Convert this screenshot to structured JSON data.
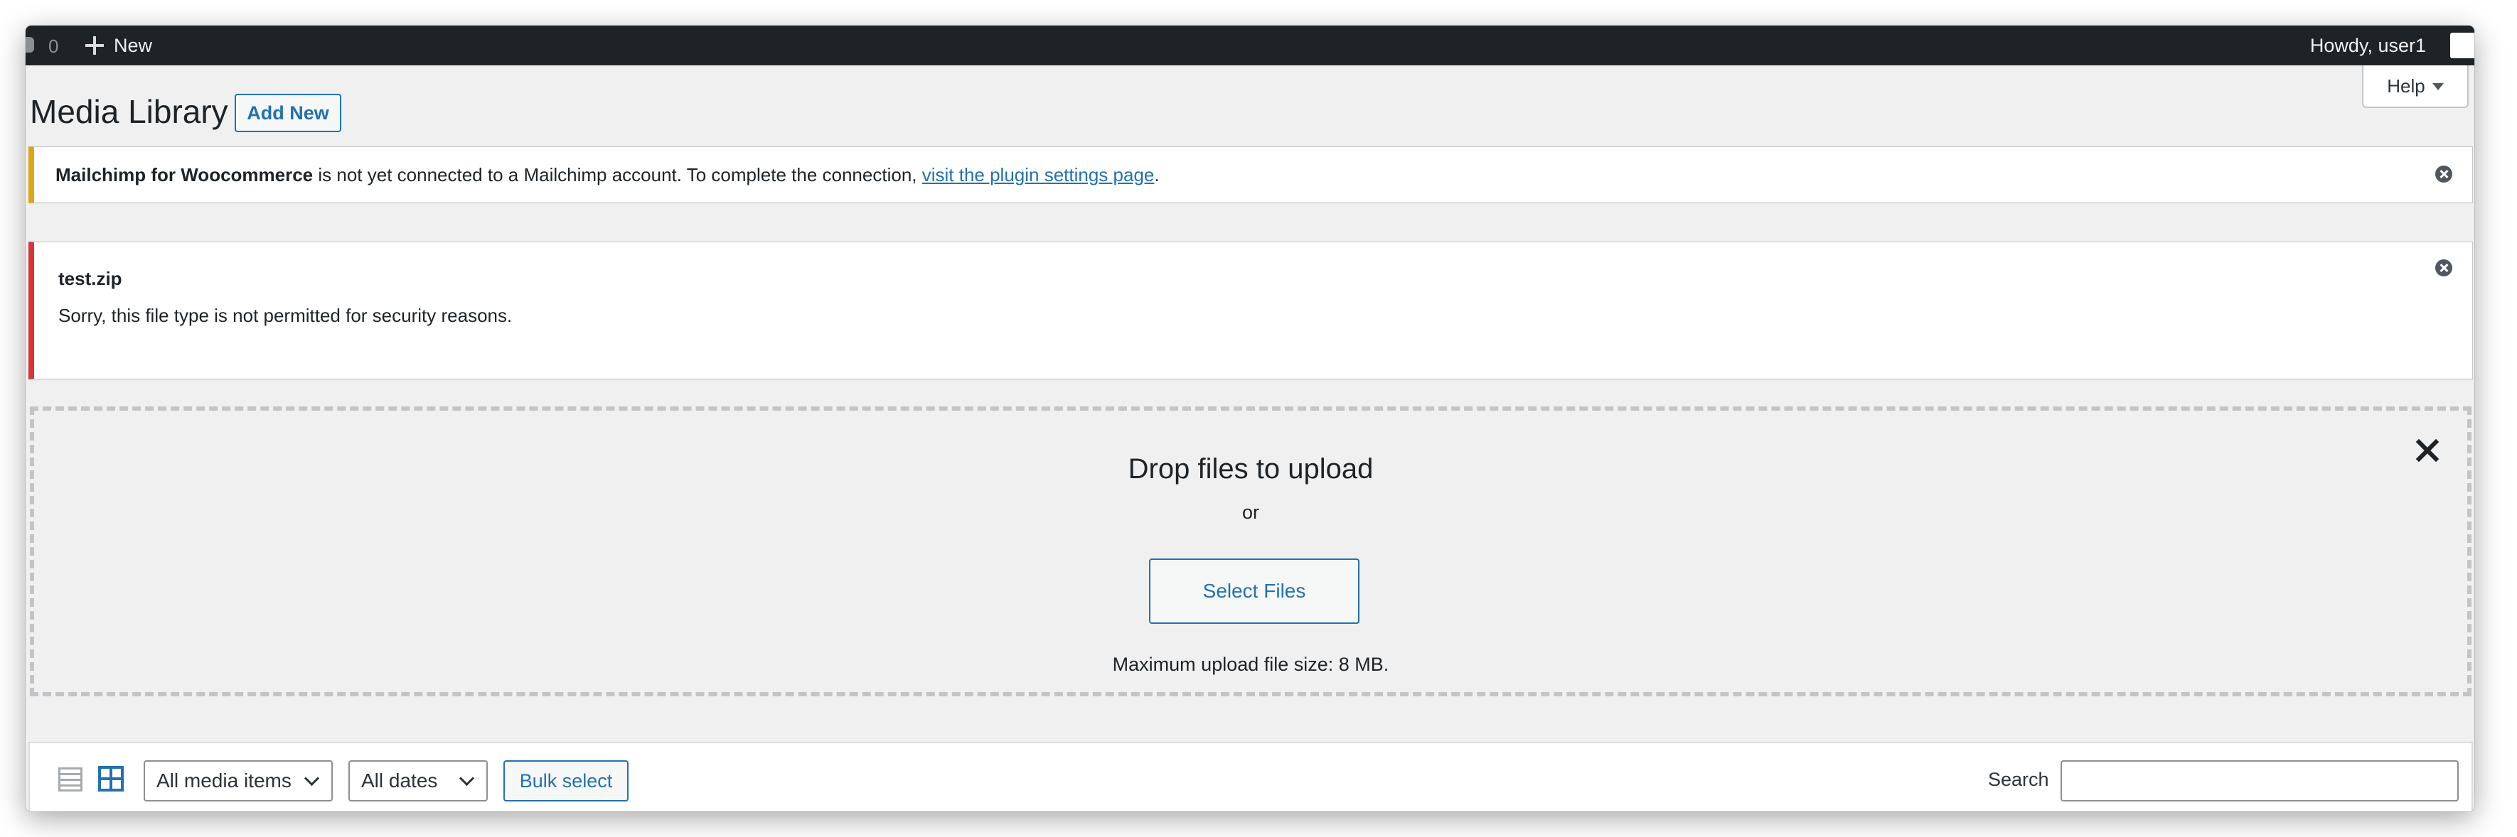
{
  "admin_bar": {
    "comment_count": "0",
    "new_label": "New",
    "howdy": "Howdy, user1"
  },
  "header": {
    "title": "Media Library",
    "add_new_label": "Add New",
    "help_label": "Help"
  },
  "notices": {
    "mailchimp": {
      "bold": "Mailchimp for Woocommerce",
      "text": " is not yet connected to a Mailchimp account. To complete the connection, ",
      "link": "visit the plugin settings page",
      "tail": "."
    },
    "error": {
      "filename": "test.zip",
      "message": "Sorry, this file type is not permitted for security reasons."
    }
  },
  "uploader": {
    "title": "Drop files to upload",
    "or": "or",
    "select_files_label": "Select Files",
    "max_size": "Maximum upload file size: 8 MB."
  },
  "toolbar": {
    "type_filter": "All media items",
    "date_filter": "All dates",
    "bulk_select_label": "Bulk select",
    "search_label": "Search",
    "search_value": ""
  },
  "colors": {
    "admin_bar": "#1d2327",
    "accent": "#2271b1",
    "warning_border": "#dba617",
    "error_border": "#d63638",
    "page_background": "#f0f0f1"
  },
  "icons": [
    "comment-icon",
    "plus-icon",
    "caret-icon",
    "dismiss-icon",
    "close-icon",
    "list-view-icon",
    "grid-view-icon",
    "chevron-down-icon"
  ]
}
